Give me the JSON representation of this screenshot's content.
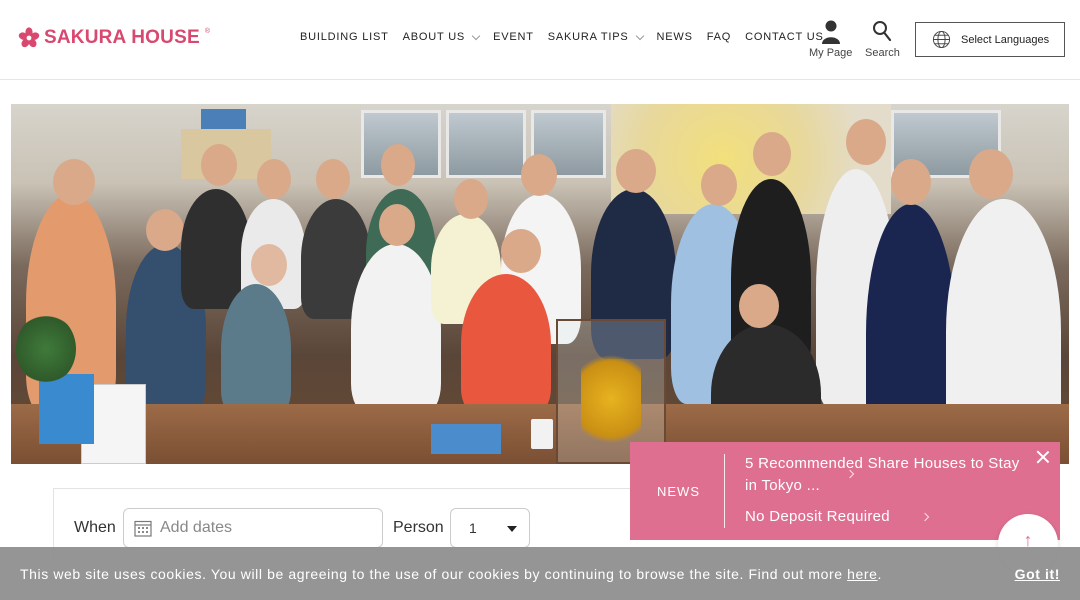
{
  "logo": {
    "text": "SAKURA HOUSE",
    "reg": "®",
    "brand_color": "#d9486f",
    "icon": "sakura-flower-icon"
  },
  "nav": {
    "items": [
      {
        "label": "BUILDING LIST",
        "has_dropdown": false
      },
      {
        "label": "ABOUT US",
        "has_dropdown": true
      },
      {
        "label": "EVENT",
        "has_dropdown": false
      },
      {
        "label": "SAKURA TIPS",
        "has_dropdown": true
      },
      {
        "label": "NEWS",
        "has_dropdown": false
      },
      {
        "label": "FAQ",
        "has_dropdown": false
      },
      {
        "label": "CONTACT US",
        "has_dropdown": false
      }
    ],
    "mypage_label": "My Page",
    "search_label": "Search",
    "language_label": "Select Languages"
  },
  "search": {
    "when_label": "When",
    "dates_placeholder": "Add dates",
    "person_label": "Person",
    "person_value": "1"
  },
  "news": {
    "label": "NEWS",
    "items": [
      {
        "title_line1": "5 Recommended Share Houses to Stay",
        "title_line2": "in Tokyo ..."
      },
      {
        "title_line1": "No Deposit Required"
      }
    ],
    "bg_color": "#df6f91"
  },
  "totop": {
    "label": "↑"
  },
  "cookie": {
    "text_before": "This web site uses cookies. You will be agreeing to the use of our cookies by continuing to browse the site. Find out more ",
    "link": "here",
    "text_after": ".",
    "ok_label": "Got it!"
  }
}
